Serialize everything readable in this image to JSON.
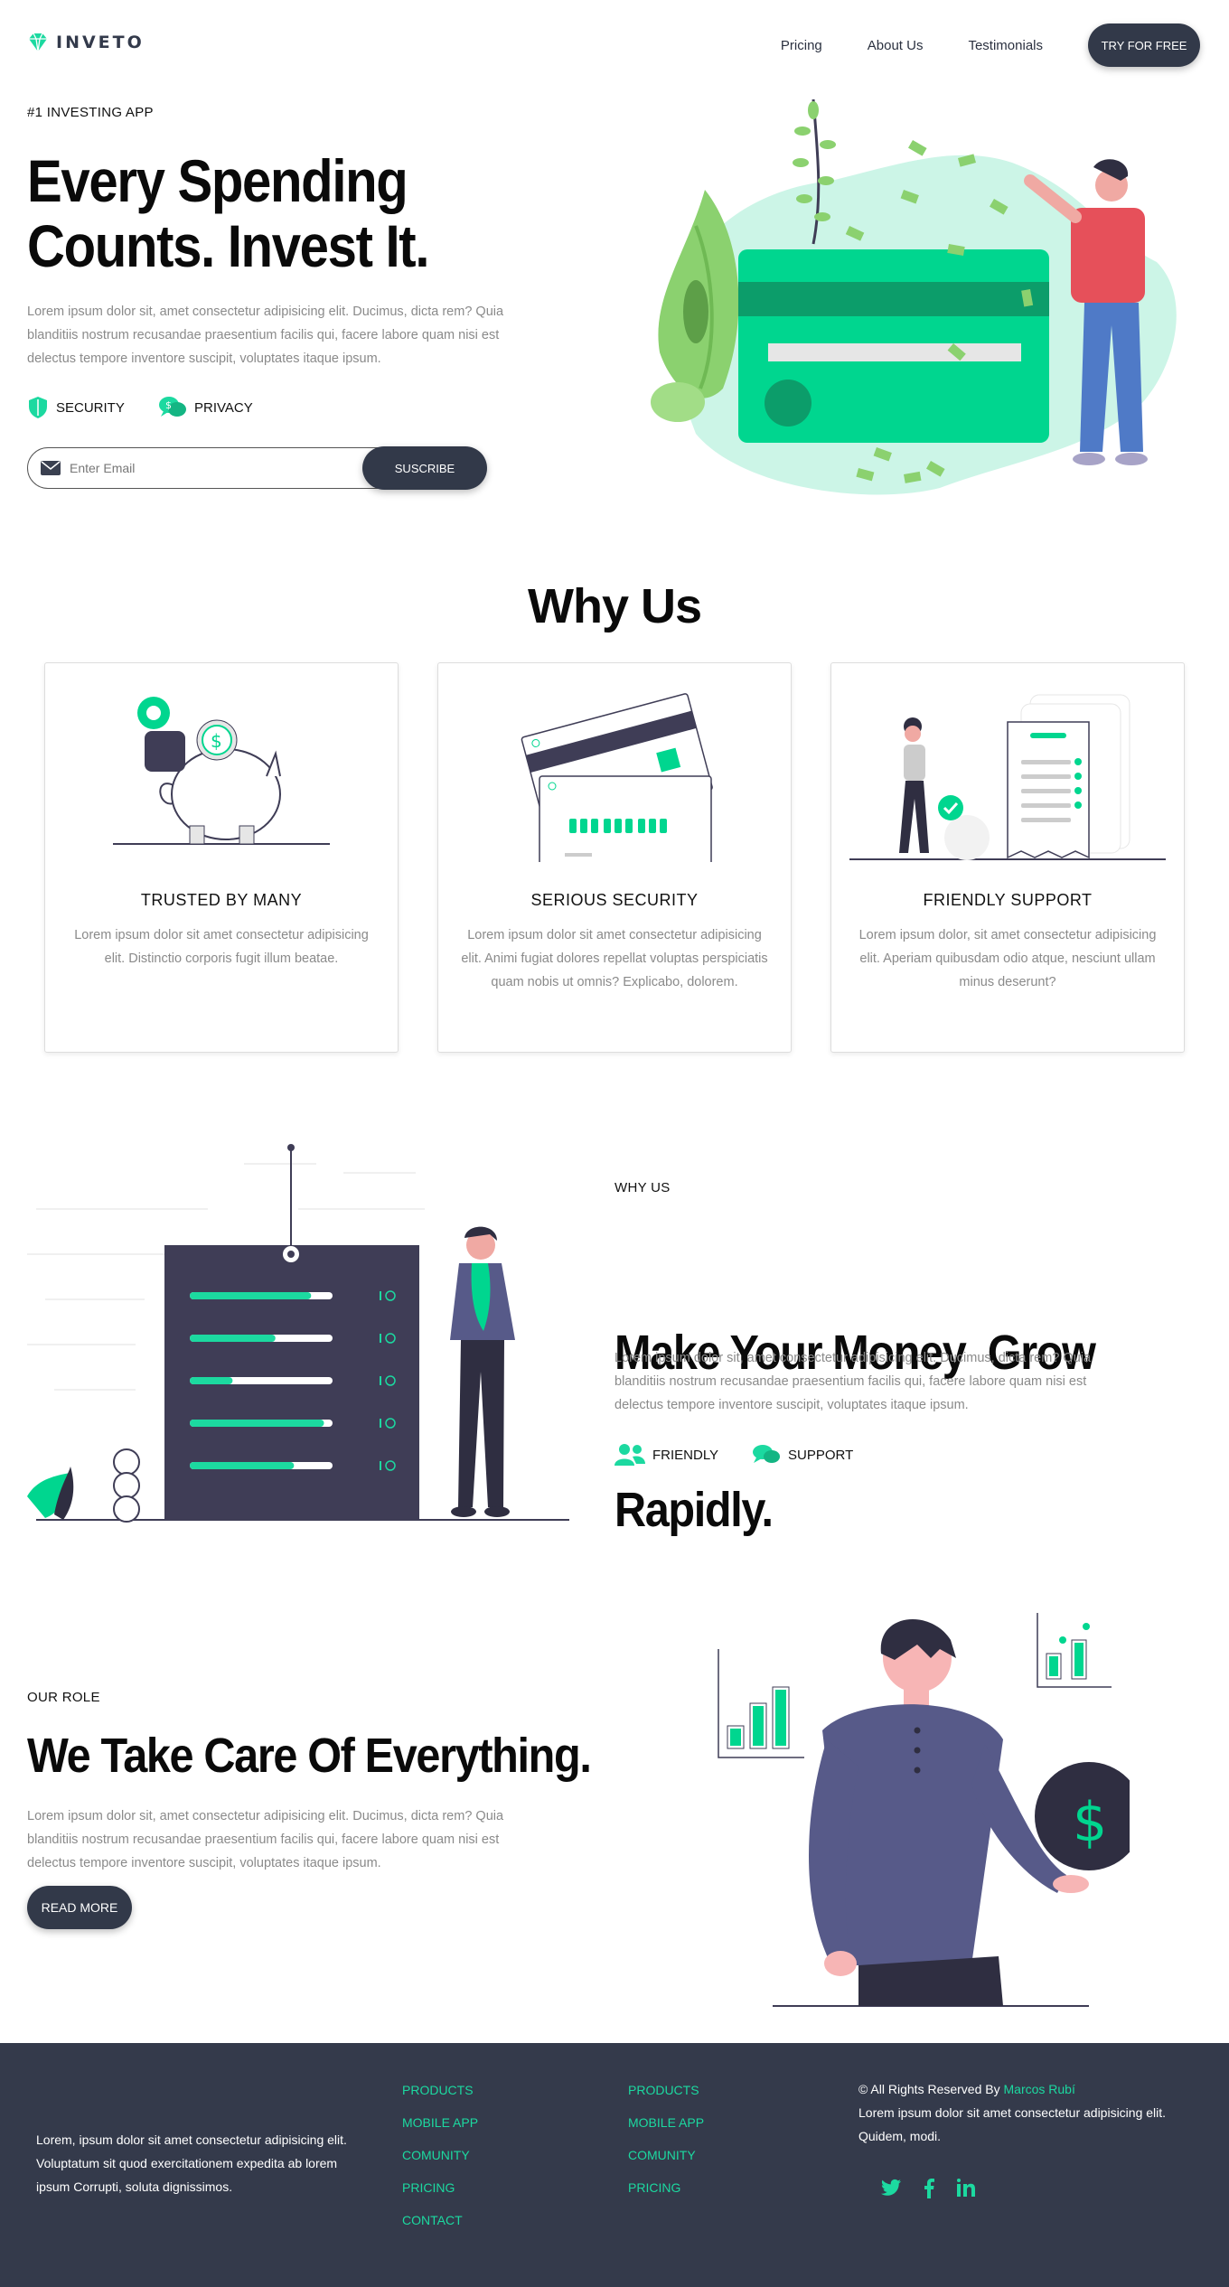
{
  "header": {
    "brand": "INVETO",
    "nav": [
      "Pricing",
      "About Us",
      "Testimonials"
    ],
    "cta": "TRY FOR FREE"
  },
  "hero": {
    "eyebrow": "#1 INVESTING APP",
    "title_line1": "Every Spending",
    "title_line2": "Counts. Invest It.",
    "body": "Lorem ipsum dolor sit, amet consectetur adipisicing elit. Ducimus, dicta rem? Quia blanditiis nostrum recusandae praesentium facilis qui, facere labore quam nisi est delectus tempore inventore suscipit, voluptates itaque ipsum.",
    "features": [
      "SECURITY",
      "PRIVACY"
    ],
    "email_placeholder": "Enter Email",
    "subscribe": "SUSCRIBE"
  },
  "why": {
    "title": "Why Us",
    "cards": [
      {
        "title": "TRUSTED BY MANY",
        "body": "Lorem ipsum dolor sit amet consectetur adipisicing elit. Distinctio corporis fugit illum beatae."
      },
      {
        "title": "SERIOUS SECURITY",
        "body": "Lorem ipsum dolor sit amet consectetur adipisicing elit. Animi fugiat dolores repellat voluptas perspiciatis quam nobis ut omnis? Explicabo, dolorem."
      },
      {
        "title": "FRIENDLY SUPPORT",
        "body": "Lorem ipsum dolor, sit amet consectetur adipisicing elit. Aperiam quibusdam odio atque, nesciunt ullam minus deserunt?"
      }
    ]
  },
  "grow": {
    "eyebrow": "WHY US",
    "title_line1": "Make Your Money  Grow",
    "title_line2": "Rapidly.",
    "body": "Lorem ipsum dolor sit, amet consectetur adipisicing elit. Ducimus, dicta rem? Quia blanditiis nostrum recusandae praesentium facilis qui, facere labore quam nisi est delectus tempore inventore suscipit, voluptates itaque ipsum.",
    "features": [
      "FRIENDLY",
      "SUPPORT"
    ],
    "progress": [
      0.85,
      0.6,
      0.3,
      0.94,
      0.73
    ]
  },
  "role": {
    "eyebrow": "OUR ROLE",
    "title": "We Take Care Of Everything.",
    "body": "Lorem ipsum dolor sit, amet consectetur adipisicing elit. Ducimus, dicta rem? Quia blanditiis nostrum recusandae praesentium facilis qui, facere labore quam nisi est delectus tempore inventore suscipit, voluptates itaque ipsum.",
    "cta": "READ MORE"
  },
  "footer": {
    "about": "Lorem, ipsum dolor sit amet consectetur adipisicing elit. Voluptatum sit quod exercitationem expedita ab lorem ipsum Corrupti, soluta dignissimos.",
    "col1": [
      "PRODUCTS",
      "MOBILE APP",
      "COMUNITY",
      "PRICING",
      "CONTACT"
    ],
    "col2": [
      "PRODUCTS",
      "MOBILE APP",
      "COMUNITY",
      "PRICING"
    ],
    "rights_prefix": "© All Rights Reserved By ",
    "rights_author": "Marcos Rubí",
    "rights_body": "Lorem ipsum dolor sit amet consectetur adipisicing elit. Quidem, modi.",
    "social": [
      "twitter-icon",
      "facebook-icon",
      "linkedin-icon"
    ]
  },
  "colors": {
    "accent": "#1cd9a0",
    "dark": "#343a4b",
    "navy": "#3f3d56"
  }
}
